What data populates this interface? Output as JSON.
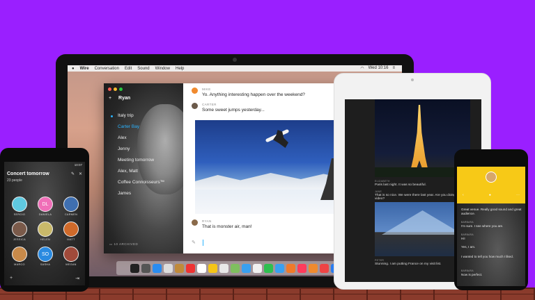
{
  "mac": {
    "menubar": {
      "app": "Wire",
      "items": [
        "Conversation",
        "Edit",
        "Sound",
        "Window",
        "Help"
      ],
      "clock": "Wed 10:16"
    },
    "sidebar": {
      "user": "Ryan",
      "conversations": [
        "Italy trip",
        "Carter Bay",
        "Alex",
        "Jenny",
        "Meeting tomorrow",
        "Alex, Matt",
        "Coffee Connoisseurs™",
        "James"
      ],
      "archived": "10 ARCHIVED"
    },
    "messages": [
      {
        "name": "MIKE",
        "text": "Yo. Anything interesting happen over the weekend?",
        "avatar_color": "#f08a2e",
        "initials": "M"
      },
      {
        "name": "CARTER",
        "text": "Some sweet jumps yesterday...",
        "avatar_color": "#6b5a4a"
      },
      {
        "name": "RYAN",
        "text": "That is monster air, man!",
        "avatar_color": "#8a6a4a"
      }
    ],
    "dock_colors": [
      "#222",
      "#555",
      "#2a8cf0",
      "#ddd",
      "#c08a3a",
      "#e33",
      "#fff",
      "#f5c518",
      "#e8e8e8",
      "#7fbf5f",
      "#3aa0f0",
      "#f0f0f0",
      "#2fbf4f",
      "#3aa0f0",
      "#f07a2a",
      "#ff3b5c",
      "#f08a2e",
      "#e44",
      "#2a7cf0"
    ]
  },
  "android": {
    "status_time": "10:07",
    "title": "Concert tomorrow",
    "subtitle": "23 people",
    "participants": [
      {
        "name": "SERGIO",
        "initials": "",
        "color": "#5fc9e0"
      },
      {
        "name": "DANIELA",
        "initials": "DL",
        "color": "#f06fb8"
      },
      {
        "name": "CARMEN",
        "initials": "",
        "color": "#3f6fb0"
      },
      {
        "name": "JESSICA",
        "initials": "",
        "color": "#7a5a4a"
      },
      {
        "name": "HELEN",
        "initials": "",
        "color": "#c9b96a"
      },
      {
        "name": "MATT",
        "initials": "",
        "color": "#d06a2a"
      },
      {
        "name": "MARCO",
        "initials": "",
        "color": "#c88a4a"
      },
      {
        "name": "SASHA",
        "initials": "SO",
        "color": "#2a8ae0"
      },
      {
        "name": "MEGAN",
        "initials": "",
        "color": "#a04a3a"
      }
    ]
  },
  "ipad": {
    "messages": [
      {
        "name": "ELIZABETH",
        "text": "Paris last night. It was so beautiful."
      },
      {
        "name": "JANE",
        "text": "That is so nice. We were there last year. Are you doing our roadtrip video?"
      },
      {
        "name": "PETER",
        "text": "Stunning. I am putting France on my visit list."
      }
    ]
  },
  "iphone": {
    "messages": [
      {
        "name": "",
        "text": "Great venue. Really good sound and great audience."
      },
      {
        "name": "BARBARA",
        "text": "I'm sure. I see where you are."
      },
      {
        "name": "BARBARA",
        "text": "Hi!"
      },
      {
        "name": "",
        "text": "Yes, I am."
      },
      {
        "name": "",
        "text": "I wanted to tell you how much I liked."
      },
      {
        "name": "BARBARA",
        "text": "Now is perfect."
      }
    ]
  }
}
